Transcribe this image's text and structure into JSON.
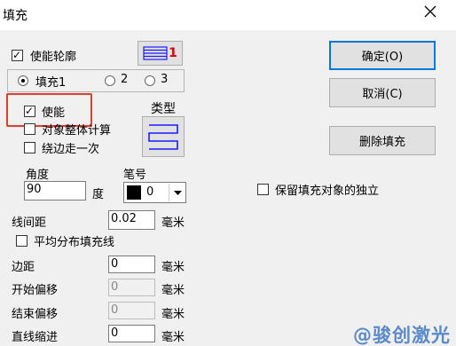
{
  "window": {
    "title": "填充"
  },
  "fill_enable": {
    "label": "使能轮廓",
    "checked": true,
    "color_index": "1"
  },
  "fill_tabs": [
    {
      "label": "填充1",
      "selected": true
    },
    {
      "label": "2",
      "selected": false
    },
    {
      "label": "3",
      "selected": false
    }
  ],
  "enable": {
    "label": "使能",
    "checked": true
  },
  "type_label": "类型",
  "whole_calc": {
    "label": "对象整体计算",
    "checked": false
  },
  "edge_once": {
    "label": "绕边走一次",
    "checked": false
  },
  "angle": {
    "label": "角度",
    "value": "90",
    "unit": "度"
  },
  "pen": {
    "label": "笔号",
    "value": "0"
  },
  "line_spacing": {
    "label": "线间距",
    "value": "0.02",
    "unit": "毫米"
  },
  "avg_distribute": {
    "label": "平均分布填充线",
    "checked": false
  },
  "margin": {
    "label": "边距",
    "value": "0",
    "unit": "毫米"
  },
  "start_offset": {
    "label": "开始偏移",
    "value": "0",
    "unit": "毫米"
  },
  "end_offset": {
    "label": "结束偏移",
    "value": "0",
    "unit": "毫米"
  },
  "line_indent": {
    "label": "直线缩进",
    "value": "0",
    "unit": "毫米"
  },
  "buttons": {
    "ok": "确定(O)",
    "cancel": "取消(C)",
    "delete_fill": "删除填充"
  },
  "keep_independent": {
    "label": "保留填充对象的独立",
    "checked": false
  },
  "watermark": "@骏创激光",
  "colors": {
    "highlight": "#e53b2a",
    "swatch_blue": "#1a1aff",
    "index_red": "#d40000"
  }
}
